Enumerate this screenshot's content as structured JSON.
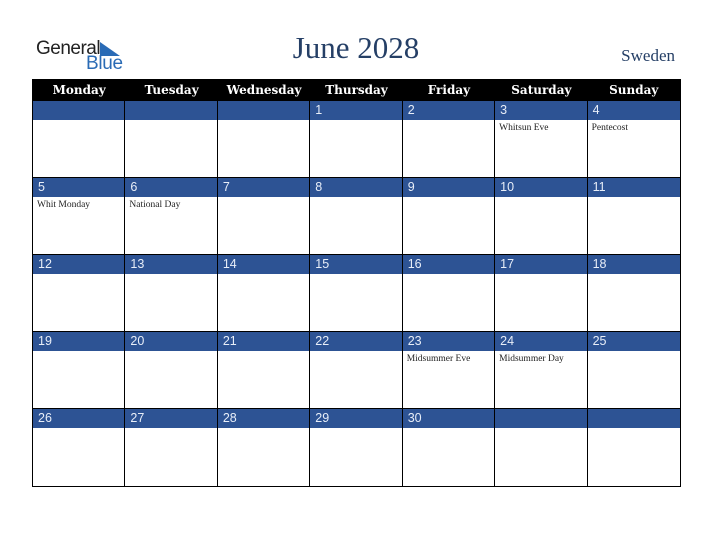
{
  "logo": {
    "general": "General",
    "blue": "Blue"
  },
  "title": "June 2028",
  "country": "Sweden",
  "weekdays": [
    "Monday",
    "Tuesday",
    "Wednesday",
    "Thursday",
    "Friday",
    "Saturday",
    "Sunday"
  ],
  "weeks": [
    [
      {
        "day": "",
        "holiday": ""
      },
      {
        "day": "",
        "holiday": ""
      },
      {
        "day": "",
        "holiday": ""
      },
      {
        "day": "1",
        "holiday": ""
      },
      {
        "day": "2",
        "holiday": ""
      },
      {
        "day": "3",
        "holiday": "Whitsun Eve"
      },
      {
        "day": "4",
        "holiday": "Pentecost"
      }
    ],
    [
      {
        "day": "5",
        "holiday": "Whit Monday"
      },
      {
        "day": "6",
        "holiday": "National Day"
      },
      {
        "day": "7",
        "holiday": ""
      },
      {
        "day": "8",
        "holiday": ""
      },
      {
        "day": "9",
        "holiday": ""
      },
      {
        "day": "10",
        "holiday": ""
      },
      {
        "day": "11",
        "holiday": ""
      }
    ],
    [
      {
        "day": "12",
        "holiday": ""
      },
      {
        "day": "13",
        "holiday": ""
      },
      {
        "day": "14",
        "holiday": ""
      },
      {
        "day": "15",
        "holiday": ""
      },
      {
        "day": "16",
        "holiday": ""
      },
      {
        "day": "17",
        "holiday": ""
      },
      {
        "day": "18",
        "holiday": ""
      }
    ],
    [
      {
        "day": "19",
        "holiday": ""
      },
      {
        "day": "20",
        "holiday": ""
      },
      {
        "day": "21",
        "holiday": ""
      },
      {
        "day": "22",
        "holiday": ""
      },
      {
        "day": "23",
        "holiday": "Midsummer Eve"
      },
      {
        "day": "24",
        "holiday": "Midsummer Day"
      },
      {
        "day": "25",
        "holiday": ""
      }
    ],
    [
      {
        "day": "26",
        "holiday": ""
      },
      {
        "day": "27",
        "holiday": ""
      },
      {
        "day": "28",
        "holiday": ""
      },
      {
        "day": "29",
        "holiday": ""
      },
      {
        "day": "30",
        "holiday": ""
      },
      {
        "day": "",
        "holiday": ""
      },
      {
        "day": "",
        "holiday": ""
      }
    ]
  ],
  "colors": {
    "header_bg": "#000000",
    "day_bar": "#2d5394",
    "title": "#253f66",
    "logo_blue": "#2a6bb5"
  }
}
